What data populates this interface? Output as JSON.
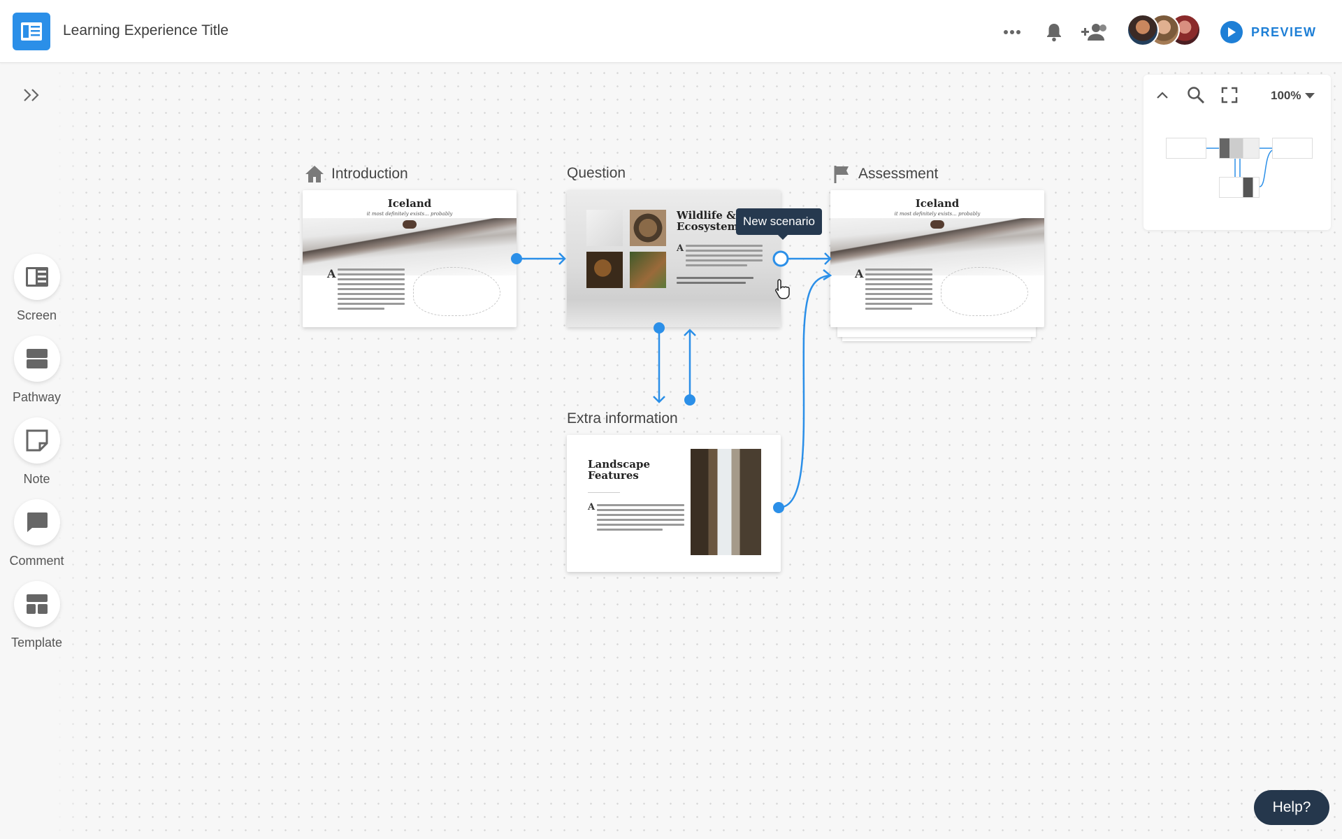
{
  "header": {
    "title": "Learning Experience Title",
    "preview_label": "PREVIEW",
    "icons": [
      "more-icon",
      "bell-icon",
      "add-user-icon"
    ],
    "avatar_count": 3
  },
  "toolbar": {
    "tools": [
      {
        "name": "screen",
        "label": "Screen",
        "icon": "screen-icon"
      },
      {
        "name": "pathway",
        "label": "Pathway",
        "icon": "pathway-icon"
      },
      {
        "name": "note",
        "label": "Note",
        "icon": "note-icon"
      },
      {
        "name": "comment",
        "label": "Comment",
        "icon": "comment-icon"
      },
      {
        "name": "template",
        "label": "Template",
        "icon": "template-icon"
      }
    ]
  },
  "minimap": {
    "zoom_label": "100%"
  },
  "nodes": {
    "introduction": {
      "label": "Introduction",
      "card_title": "Iceland",
      "card_subtitle": "it most definitely exists... probably"
    },
    "question": {
      "label": "Question",
      "card_title_line1": "Wildlife &",
      "card_title_line2": "Ecosystem"
    },
    "assessment": {
      "label": "Assessment",
      "card_title": "Iceland",
      "card_subtitle": "it most definitely exists... probably"
    },
    "extra": {
      "label": "Extra information",
      "card_title_line1": "Landscape",
      "card_title_line2": "Features"
    }
  },
  "tooltip": {
    "text": "New scenario"
  },
  "help": {
    "label": "Help?"
  },
  "colors": {
    "accent": "#2b8fe8",
    "connector": "#2b8fe8",
    "tooltip_bg": "#26394f"
  }
}
